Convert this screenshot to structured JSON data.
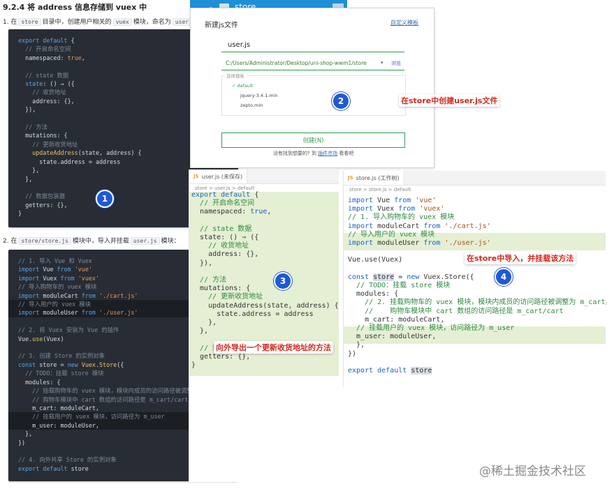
{
  "doc": {
    "section_title": "9.2.4 将 address 信息存储到 vuex 中",
    "step1": {
      "prefix": "1. 在",
      "dir": "store",
      "mid1": "目录中，创建用户相关的",
      "mod": "vuex",
      "mid2": "模块，命名为",
      "file": "user.js",
      "suffix": "："
    },
    "step2": {
      "prefix": "2. 在",
      "file": "store/store.js",
      "mid1": "模块中，导入并挂载",
      "mod": "user.js",
      "suffix": "模块："
    }
  },
  "badges": [
    "1",
    "2",
    "3",
    "4"
  ],
  "notes": {
    "create_file": "在store中创建user.js文件",
    "export_method": "向外导出一个更新收货地址的方法",
    "import_mount": "在store中导入，并挂载该方法"
  },
  "dialog": {
    "folder_name": "store",
    "title": "新建js文件",
    "custom_template_link": "自定义模板",
    "filename_value": "user.js",
    "path_value": "C:/Users/Administrator/Desktop/uni-shop-wwm1/store",
    "browse_label": "浏览",
    "template_legend": "选择模板",
    "templates": [
      "default",
      "jquery-3.4.1.min",
      "zepto.min"
    ],
    "create_button": "创建(N)",
    "footer_text": "没有找到想要的? 到",
    "footer_link": "插件市场",
    "footer_suffix": "看看吧"
  },
  "editor_user": {
    "tab_title": "user.js (未保存)",
    "breadcrumb": [
      "store",
      "user.js",
      "default"
    ]
  },
  "editor_store": {
    "tab_title": "store.js (工作树)",
    "breadcrumb": [
      "store",
      "store.js",
      "default"
    ]
  },
  "watermark": "@稀土掘金技术社区",
  "colors": {
    "badge": "#1f59d6",
    "note_text": "#d4281d",
    "dark_bg": "#282c34",
    "green_highlight": "#e4efd3"
  }
}
